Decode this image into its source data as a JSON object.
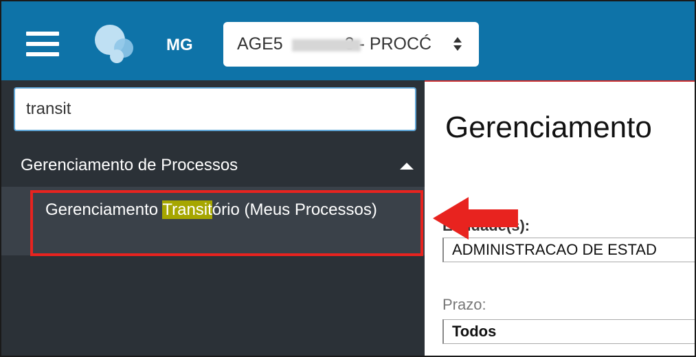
{
  "header": {
    "menu_icon": "hamburger-icon",
    "logo_icon": "app-logo",
    "org": "MG",
    "unit_select": "AGE5   3 - PROCĆ",
    "unit_select_visible": "AGE5",
    "unit_select_rest": "3 - PROCĆ",
    "select_arrows_icon": "sort-arrows-icon",
    "colors": {
      "bar": "#0e73a8"
    }
  },
  "sidebar": {
    "search_value": "transit",
    "group_label": "Gerenciamento de Processos",
    "group_caret_icon": "caret-up-icon",
    "item": {
      "before": "Gerenciamento ",
      "highlight": "Transit",
      "after": "ório (Meus Processos)"
    }
  },
  "main": {
    "title": "Gerenciamento",
    "unit_label": "Entidade(s):",
    "unit_value": "ADMINISTRACAO DE ESTAD",
    "prazo_label": "Prazo:",
    "prazo_value": "Todos"
  },
  "annotation": {
    "arrow_icon": "red-arrow-icon",
    "highlight_color": "#e8231f"
  }
}
